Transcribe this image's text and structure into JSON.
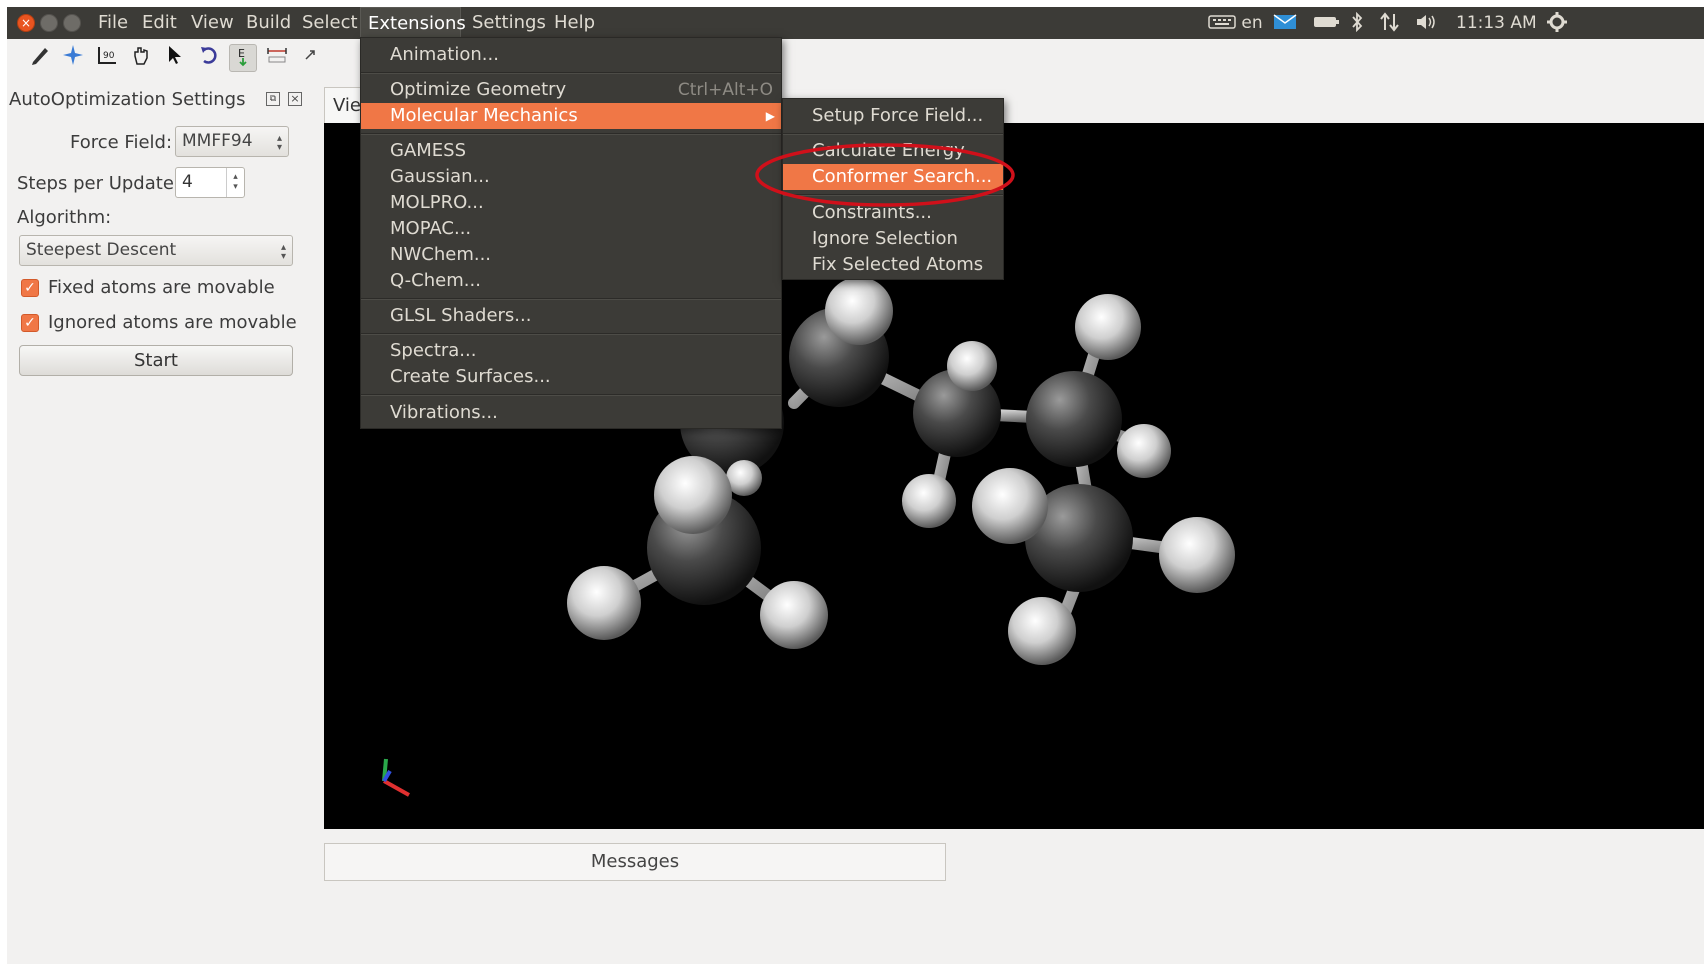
{
  "menubar": {
    "items": [
      "File",
      "Edit",
      "View",
      "Build",
      "Select",
      "Extensions",
      "Settings",
      "Help"
    ],
    "active": "Extensions"
  },
  "tray": {
    "keyboard_lang": "en",
    "time": "11:13 AM",
    "icons": [
      "keyboard-icon",
      "mail-icon",
      "battery-icon",
      "bluetooth-icon",
      "network-icon",
      "volume-icon",
      "gear-icon"
    ]
  },
  "toolbar": {
    "tools": [
      "draw-tool-icon",
      "navigate-tool-icon",
      "measure-tool-icon",
      "manipulate-tool-icon",
      "select-tool-icon",
      "rotate-tool-icon",
      "auto-optimization-tool-icon",
      "align-tool-icon",
      "symmetry-tool-icon"
    ]
  },
  "panel": {
    "title": "AutoOptimization Settings",
    "force_field_label": "Force Field:",
    "force_field_value": "MMFF94",
    "steps_label": "Steps per Update:",
    "steps_value": "4",
    "algorithm_label": "Algorithm:",
    "algorithm_value": "Steepest Descent",
    "fixed_label": "Fixed atoms are movable",
    "ignored_label": "Ignored atoms are movable",
    "start_label": "Start"
  },
  "view_tab": "Vie",
  "messages_label": "Messages",
  "extensions_menu": {
    "items": [
      {
        "label": "Animation..."
      },
      {
        "label": "Optimize Geometry",
        "shortcut": "Ctrl+Alt+O"
      },
      {
        "label": "Molecular Mechanics",
        "highlighted": true
      },
      {
        "label": "GAMESS"
      },
      {
        "label": "Gaussian..."
      },
      {
        "label": "MOLPRO..."
      },
      {
        "label": "MOPAC..."
      },
      {
        "label": "NWChem..."
      },
      {
        "label": "Q-Chem..."
      },
      {
        "label": "GLSL Shaders..."
      },
      {
        "label": "Spectra..."
      },
      {
        "label": "Create Surfaces..."
      },
      {
        "label": "Vibrations..."
      }
    ]
  },
  "mm_submenu": {
    "items": [
      {
        "label": "Setup Force Field..."
      },
      {
        "label": "Calculate Energy"
      },
      {
        "label": "Conformer Search...",
        "highlighted": true
      },
      {
        "label": "Constraints..."
      },
      {
        "label": "Ignore Selection"
      },
      {
        "label": "Fix Selected Atoms"
      }
    ]
  },
  "colors": {
    "menu_bg": "#3c3b37",
    "highlight": "#f07746",
    "annotation": "#d0101a"
  }
}
